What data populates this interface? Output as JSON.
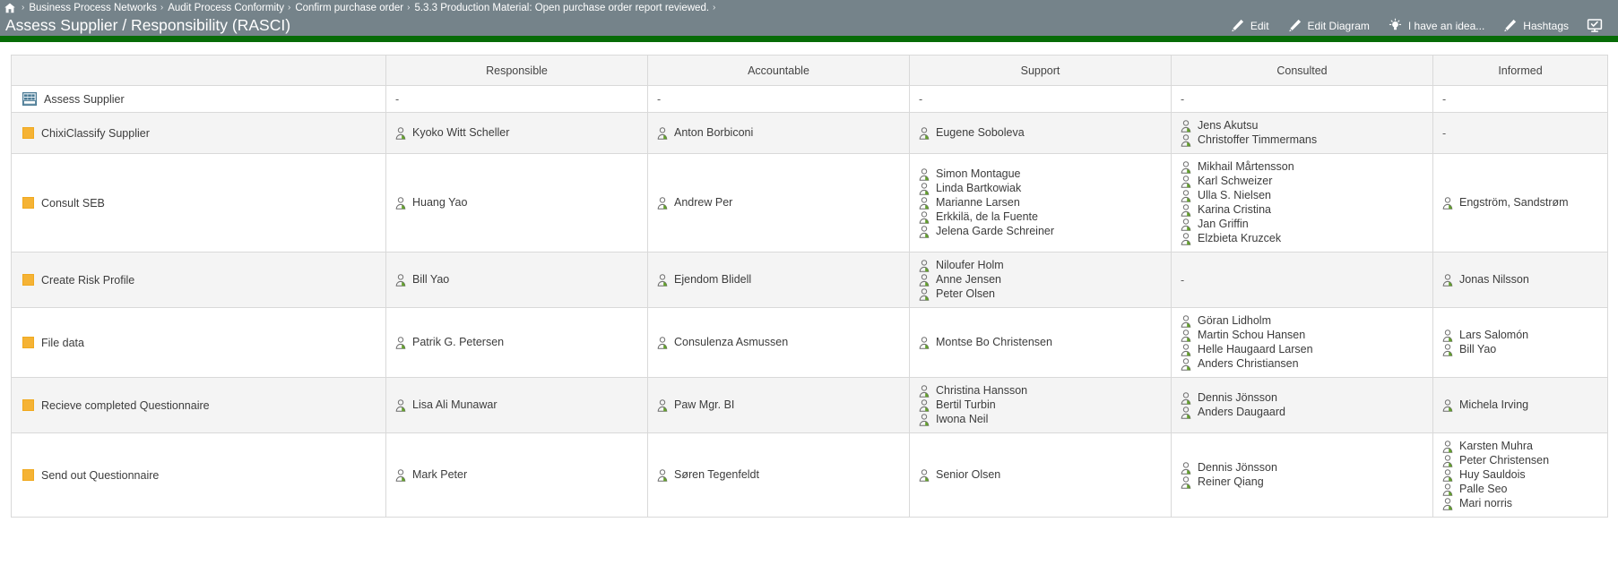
{
  "topbar": {
    "home_icon": "home-icon",
    "breadcrumb": [
      "Business Process Networks",
      "Audit Process Conformity",
      "Confirm purchase order",
      "5.3.3 Production Material: Open purchase order report reviewed."
    ],
    "breadcrumb_separator": "›",
    "page_title": "Assess Supplier / Responsibility (RASCI)",
    "toolbar": [
      {
        "label": "Edit",
        "icon": "pencil-icon"
      },
      {
        "label": "Edit Diagram",
        "icon": "pencil-icon"
      },
      {
        "label": "I have an idea...",
        "icon": "lightbulb-icon"
      },
      {
        "label": "Hashtags",
        "icon": "pencil-icon"
      },
      {
        "label": "",
        "icon": "monitor-check-icon"
      }
    ],
    "background_color": "#75838a",
    "accent_bar_color": "#076b07"
  },
  "table": {
    "columns": [
      "",
      "Responsible",
      "Accountable",
      "Support",
      "Consulted",
      "Informed"
    ],
    "empty_marker": "-",
    "rows": [
      {
        "task": "Assess Supplier",
        "icon": "process-table-icon",
        "responsible": [],
        "accountable": [],
        "support": [],
        "consulted": [],
        "informed": []
      },
      {
        "task": "ChixiClassify Supplier",
        "icon": "yellow-square-icon",
        "responsible": [
          "Kyoko Witt Scheller"
        ],
        "accountable": [
          "Anton Borbiconi"
        ],
        "support": [
          "Eugene Soboleva"
        ],
        "consulted": [
          "Jens Akutsu",
          "Christoffer Timmermans"
        ],
        "informed": []
      },
      {
        "task": "Consult SEB",
        "icon": "yellow-square-icon",
        "responsible": [
          "Huang Yao"
        ],
        "accountable": [
          "Andrew Per"
        ],
        "support": [
          "Simon Montague",
          "Linda Bartkowiak",
          "Marianne Larsen",
          "Erkkilä, de la Fuente",
          "Jelena Garde Schreiner"
        ],
        "consulted": [
          "Mikhail Mårtensson",
          "Karl Schweizer",
          "Ulla S. Nielsen",
          "Karina Cristina",
          "Jan Griffin",
          "Elzbieta Kruzcek"
        ],
        "informed": [
          "Engström, Sandstrøm"
        ]
      },
      {
        "task": "Create Risk Profile",
        "icon": "yellow-square-icon",
        "responsible": [
          "Bill Yao"
        ],
        "accountable": [
          "Ejendom Blidell"
        ],
        "support": [
          "Niloufer Holm",
          "Anne Jensen",
          "Peter Olsen"
        ],
        "consulted": [],
        "informed": [
          "Jonas Nilsson"
        ]
      },
      {
        "task": "File data",
        "icon": "yellow-square-icon",
        "responsible": [
          "Patrik G. Petersen"
        ],
        "accountable": [
          "Consulenza Asmussen"
        ],
        "support": [
          "Montse Bo Christensen"
        ],
        "consulted": [
          "Göran Lidholm",
          "Martin Schou Hansen",
          "Helle Haugaard Larsen",
          "Anders Christiansen"
        ],
        "informed": [
          "Lars Salomón",
          "Bill Yao"
        ]
      },
      {
        "task": "Recieve completed Questionnaire",
        "icon": "yellow-square-icon",
        "responsible": [
          "Lisa Ali Munawar"
        ],
        "accountable": [
          "Paw Mgr. BI"
        ],
        "support": [
          "Christina Hansson",
          "Bertil Turbin",
          "Iwona Neil"
        ],
        "consulted": [
          "Dennis Jönsson",
          "Anders Daugaard"
        ],
        "informed": [
          "Michela Irving"
        ]
      },
      {
        "task": "Send out Questionnaire",
        "icon": "yellow-square-icon",
        "responsible": [
          "Mark Peter"
        ],
        "accountable": [
          "Søren Tegenfeldt"
        ],
        "support": [
          "Senior Olsen"
        ],
        "consulted": [
          "Dennis Jönsson",
          "Reiner Qiang"
        ],
        "informed": [
          "Karsten Muhra",
          "Peter Christensen",
          "Huy Sauldois",
          "Palle Seo",
          "Mari norris"
        ]
      }
    ]
  }
}
